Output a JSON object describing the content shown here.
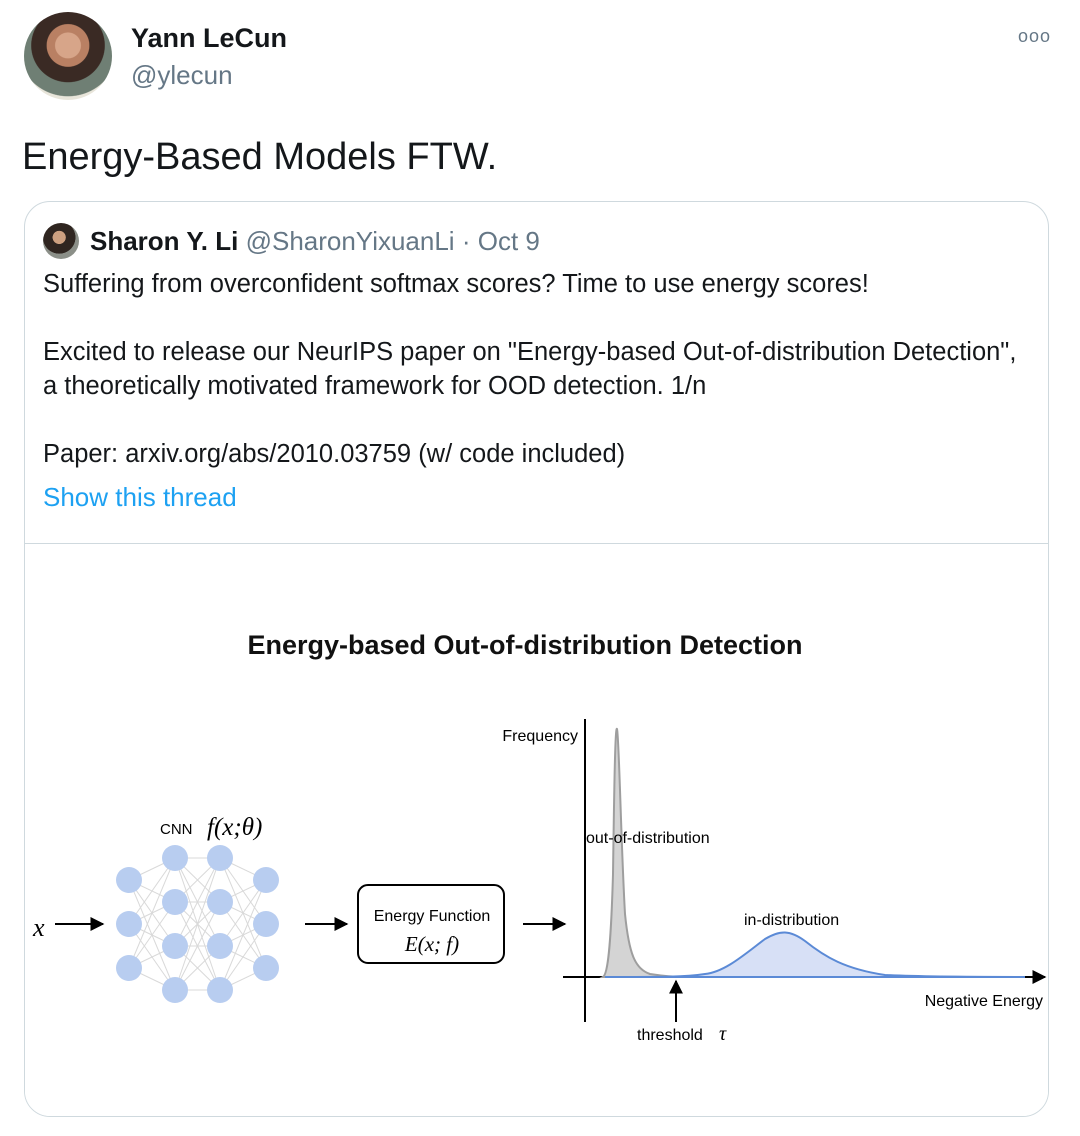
{
  "tweet": {
    "author_name": "Yann LeCun",
    "author_handle": "@ylecun",
    "more_icon": "ooo",
    "text": "Energy-Based Models FTW."
  },
  "quoted_tweet": {
    "author_name": "Sharon Y. Li",
    "author_handle": "@SharonYixuanLi",
    "separator": "·",
    "date": "Oct 9",
    "paragraphs": [
      "Suffering from overconfident softmax scores? Time to use energy scores!",
      "Excited to release our NeurIPS paper on \"Energy-based Out-of-distribution Detection\", a theoretically motivated framework for OOD detection. 1/n",
      "Paper:  arxiv.org/abs/2010.03759 (w/ code included)"
    ],
    "show_thread": "Show this thread",
    "figure": {
      "title": "Energy-based Out-of-distribution Detection",
      "input_label": "x",
      "cnn_label": "CNN",
      "cnn_function": "f(x;θ)",
      "box_label": "Energy Function",
      "box_formula": "E(x; f)",
      "y_axis_label": "Frequency",
      "x_axis_label": "Negative Energy",
      "ood_label": "out-of-distribution",
      "id_label": "in-distribution",
      "threshold_label": "threshold",
      "threshold_symbol": "τ",
      "node_color": "#b8cdf0",
      "in_dist_color": "#5b8ad6",
      "out_dist_color": "#9e9e9e"
    }
  }
}
